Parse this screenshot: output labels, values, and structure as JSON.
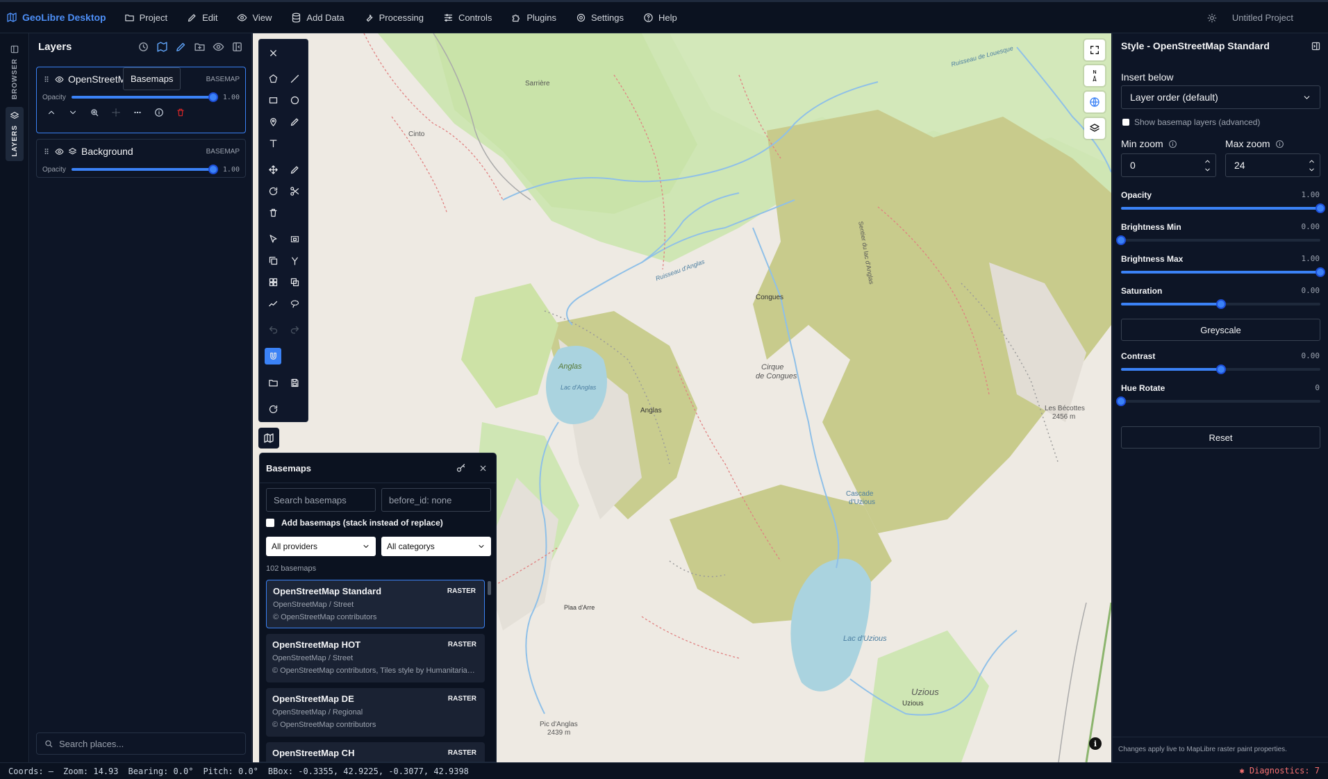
{
  "app": {
    "brand": "GeoLibre Desktop",
    "project_name": "Untitled Project"
  },
  "menu": [
    {
      "label": "Project",
      "icon": "folder-icon"
    },
    {
      "label": "Edit",
      "icon": "pencil-icon"
    },
    {
      "label": "View",
      "icon": "eye-icon"
    },
    {
      "label": "Add Data",
      "icon": "database-icon"
    },
    {
      "label": "Processing",
      "icon": "wrench-icon"
    },
    {
      "label": "Controls",
      "icon": "sliders-icon"
    },
    {
      "label": "Plugins",
      "icon": "puzzle-icon"
    },
    {
      "label": "Settings",
      "icon": "gear-icon"
    },
    {
      "label": "Help",
      "icon": "help-icon"
    }
  ],
  "rail": {
    "browser": "BROWSER",
    "layers": "LAYERS"
  },
  "layers_panel": {
    "title": "Layers",
    "tooltip": "Basemaps",
    "layers": [
      {
        "name": "OpenStreetMap Standard",
        "tag": "BASEMAP",
        "opacity_label": "Opacity",
        "opacity": "1.00"
      },
      {
        "name": "Background",
        "tag": "BASEMAP",
        "opacity_label": "Opacity",
        "opacity": "1.00"
      }
    ],
    "search_placeholder": "Search places..."
  },
  "basemaps": {
    "title": "Basemaps",
    "search_placeholder": "Search basemaps",
    "before_id_placeholder": "before_id: none",
    "stack_label": "Add basemaps (stack instead of replace)",
    "provider": "All providers",
    "category": "All categorys",
    "count": "102 basemaps",
    "items": [
      {
        "title": "OpenStreetMap Standard",
        "type": "RASTER",
        "sub": "OpenStreetMap / Street",
        "credit": "© OpenStreetMap contributors"
      },
      {
        "title": "OpenStreetMap HOT",
        "type": "RASTER",
        "sub": "OpenStreetMap / Street",
        "credit": "© OpenStreetMap contributors, Tiles style by Humanitarian OpenStreetMap Team hosted by OpenStreetMap France"
      },
      {
        "title": "OpenStreetMap DE",
        "type": "RASTER",
        "sub": "OpenStreetMap / Regional",
        "credit": "© OpenStreetMap contributors"
      },
      {
        "title": "OpenStreetMap CH",
        "type": "RASTER",
        "sub": "",
        "credit": ""
      }
    ]
  },
  "map_labels": {
    "sarriere": "Sarrière",
    "cinto": "Cinto",
    "congues": "Congues",
    "cirque": "Cirque",
    "de_congues": "de Congues",
    "anglas": "Anglas",
    "lac_anglas": "Lac d'Anglas",
    "anglas2": "Anglas",
    "les_becottes": "Les Bécottes",
    "becottes_elev": "2456 m",
    "cascade": "Cascade",
    "d_uzious": "d'Uzious",
    "lac_uzious": "Lac d'Uzious",
    "uzious_big": "Uzious",
    "uzious_small": "Uzious",
    "pic_anglas": "Pic d'Anglas",
    "pic_elev": "2439 m",
    "plaa": "Plaa d'Arre",
    "ruisseau": "Ruisseau d'Anglas",
    "louesque": "Ruisseau de Louesque",
    "sentier": "Sentier du lac d'Anglas",
    "n_label": "N"
  },
  "style_panel": {
    "title": "Style - OpenStreetMap Standard",
    "insert_below_label": "Insert below",
    "insert_below_value": "Layer order (default)",
    "show_basemap": "Show basemap layers (advanced)",
    "min_zoom_label": "Min zoom",
    "max_zoom_label": "Max zoom",
    "min_zoom": "0",
    "max_zoom": "24",
    "sliders": [
      {
        "label": "Opacity",
        "value": "1.00",
        "fraction": 1.0
      },
      {
        "label": "Brightness Min",
        "value": "0.00",
        "fraction": 0.0
      },
      {
        "label": "Brightness Max",
        "value": "1.00",
        "fraction": 1.0
      },
      {
        "label": "Saturation",
        "value": "0.00",
        "fraction": 0.5
      },
      {
        "label": "Contrast",
        "value": "0.00",
        "fraction": 0.5
      },
      {
        "label": "Hue Rotate",
        "value": "0",
        "fraction": 0.0
      }
    ],
    "greyscale": "Greyscale",
    "reset": "Reset",
    "footer": "Changes apply live to MapLibre raster paint properties."
  },
  "status": {
    "coords": "Coords: —",
    "zoom": "Zoom: 14.93",
    "bearing": "Bearing: 0.0°",
    "pitch": "Pitch: 0.0°",
    "bbox": "BBox: -0.3355, 42.9225, -0.3077, 42.9398",
    "diagnostics": "Diagnostics: 7"
  },
  "colors": {
    "accent": "#3b82f6",
    "brand": "#4d8ff7",
    "diag": "#f87171"
  }
}
